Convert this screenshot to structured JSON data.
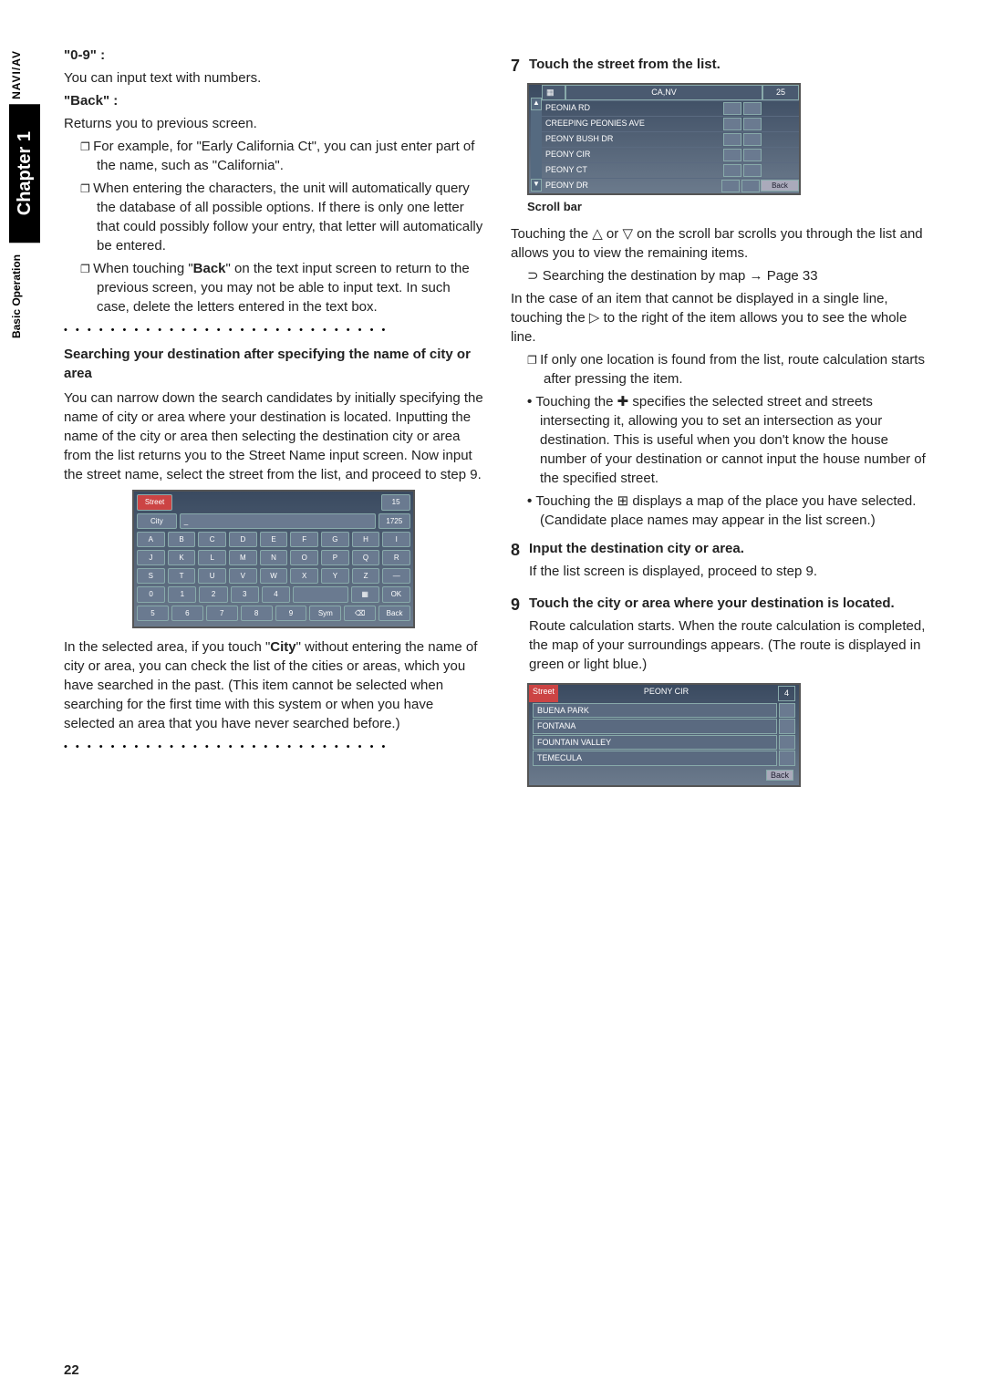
{
  "sidebar": {
    "naviav": "NAVI/AV",
    "chapter": "Chapter 1",
    "section": "Basic Operation"
  },
  "left": {
    "h1": "\"0-9\" :",
    "p1": "You can input text with numbers.",
    "h2": "\"Back\" :",
    "p2": "Returns you to previous screen.",
    "b1": "For example, for \"Early California Ct\", you can just enter part of the name, such as \"California\".",
    "b2": "When entering the characters, the unit will automatically query the database of all possible options. If there is only one letter that could possibly follow your entry, that letter will automatically be entered.",
    "b3a": "When touching \"",
    "b3bold": "Back",
    "b3b": "\" on the text input screen to return to the previous screen, you may not be able to input text. In such case, delete the letters entered in the text box.",
    "dots": "• • • • • • • • • • • • • • • • • • • • • • • • • • • •",
    "h3": "Searching your destination after specifying the name of city or area",
    "p3": "You can narrow down the search candidates by initially specifying the name of city or area where your destination is located. Inputting the name of the city or area then selecting the destination city or area from the list returns you to the Street Name input screen. Now input the street name, select the street from the list, and proceed to step 9.",
    "kb": {
      "tab1": "Street",
      "tab2": "City",
      "count1": "15",
      "count2": "1725",
      "rows": [
        [
          "A",
          "B",
          "C",
          "D",
          "E",
          "F",
          "G",
          "H",
          "I"
        ],
        [
          "J",
          "K",
          "L",
          "M",
          "N",
          "O",
          "P",
          "Q",
          "R"
        ],
        [
          "S",
          "T",
          "U",
          "V",
          "W",
          "X",
          "Y",
          "Z",
          "—"
        ],
        [
          "0",
          "1",
          "2",
          "3",
          "4",
          "",
          "",
          "",
          "OK"
        ],
        [
          "5",
          "6",
          "7",
          "8",
          "9",
          "",
          "Sym",
          "⌫",
          "Back"
        ]
      ]
    },
    "p4a": "In the selected area, if you touch \"",
    "p4bold": "City",
    "p4b": "\" without entering the name of city or area, you can check the list of the cities or areas, which you have searched in the past. (This item cannot be selected when searching for the first time with this system or when you have selected an area that you have never searched before.)"
  },
  "right": {
    "s7": {
      "num": "7",
      "title": "Touch the street from the list."
    },
    "fig1": {
      "hdr": "CA,NV",
      "count": "25",
      "rows": [
        "PEONIA RD",
        "CREEPING PEONIES AVE",
        "PEONY BUSH DR",
        "PEONY CIR",
        "PEONY CT",
        "PEONY DR"
      ],
      "back": "Back"
    },
    "scrollbar_label": "Scroll bar",
    "p1": "Touching the △ or ▽ on the scroll bar scrolls you through the list and allows you to view the remaining items.",
    "link": "Searching the destination by map → Page 33",
    "p2": "In the case of an item that cannot be displayed in a single line, touching the ▷ to the right of the item allows you to see the whole line.",
    "b1": "If only one location is found from the list, route calculation starts after pressing the item.",
    "b2": "Touching the ✚ specifies the selected street and streets intersecting it, allowing you to set an intersection as your destination. This is useful when you don't know the house number of your destination or cannot input the house number of the specified street.",
    "b3": "Touching the ⊞ displays a map of the place you have selected. (Candidate place names may appear in the list screen.)",
    "s8": {
      "num": "8",
      "title": "Input the destination city or area.",
      "body": "If the list screen is displayed, proceed to step 9."
    },
    "s9": {
      "num": "9",
      "title": "Touch the city or area where your destination is located.",
      "body": "Route calculation starts. When the route calculation is completed, the map of your surroundings appears. (The route is displayed in green or light blue.)"
    },
    "fig2": {
      "tab": "Street",
      "val": "PEONY CIR",
      "count": "4",
      "rows": [
        "BUENA PARK",
        "FONTANA",
        "FOUNTAIN VALLEY",
        "TEMECULA"
      ],
      "back": "Back"
    }
  },
  "page_num": "22"
}
